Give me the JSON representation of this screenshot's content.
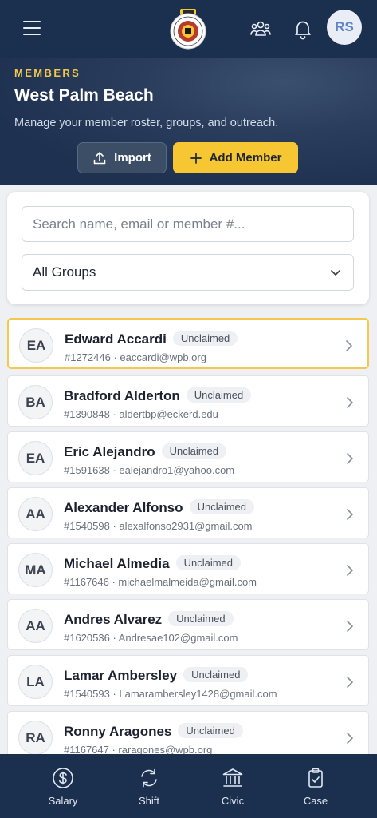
{
  "header": {
    "avatar_initials": "RS",
    "logo_icon": "union-seal-icon",
    "icons": [
      "menu-icon",
      "groups-icon",
      "bell-icon"
    ]
  },
  "hero": {
    "eyebrow": "MEMBERS",
    "title": "West Palm Beach",
    "subtitle": "Manage your member roster, groups, and outreach.",
    "import_label": "Import",
    "add_label": "Add Member"
  },
  "filters": {
    "search_placeholder": "Search name, email or member #...",
    "group_selected": "All Groups"
  },
  "members": [
    {
      "initials": "EA",
      "name": "Edward Accardi",
      "status": "Unclaimed",
      "info": "#1272446 · eaccardi@wpb.org"
    },
    {
      "initials": "BA",
      "name": "Bradford Alderton",
      "status": "Unclaimed",
      "info": "#1390848 · aldertbp@eckerd.edu"
    },
    {
      "initials": "EA",
      "name": "Eric Alejandro",
      "status": "Unclaimed",
      "info": "#1591638 · ealejandro1@yahoo.com"
    },
    {
      "initials": "AA",
      "name": "Alexander Alfonso",
      "status": "Unclaimed",
      "info": "#1540598 · alexalfonso2931@gmail.com"
    },
    {
      "initials": "MA",
      "name": "Michael Almedia",
      "status": "Unclaimed",
      "info": "#1167646 · michaelmalmeida@gmail.com"
    },
    {
      "initials": "AA",
      "name": "Andres Alvarez",
      "status": "Unclaimed",
      "info": "#1620536 · Andresae102@gmail.com"
    },
    {
      "initials": "LA",
      "name": "Lamar Ambersley",
      "status": "Unclaimed",
      "info": "#1540593 · Lamarambersley1428@gmail.com"
    },
    {
      "initials": "RA",
      "name": "Ronny Aragones",
      "status": "Unclaimed",
      "info": "#1167647 · raragones@wpb.org"
    }
  ],
  "nav": [
    {
      "label": "Salary",
      "icon": "dollar-icon"
    },
    {
      "label": "Shift",
      "icon": "swap-icon"
    },
    {
      "label": "Civic",
      "icon": "building-icon"
    },
    {
      "label": "Case",
      "icon": "clipboard-icon"
    }
  ],
  "colors": {
    "navy": "#1b2f4e",
    "accent_yellow": "#f6c733",
    "eyebrow_yellow": "#f2c94c"
  }
}
